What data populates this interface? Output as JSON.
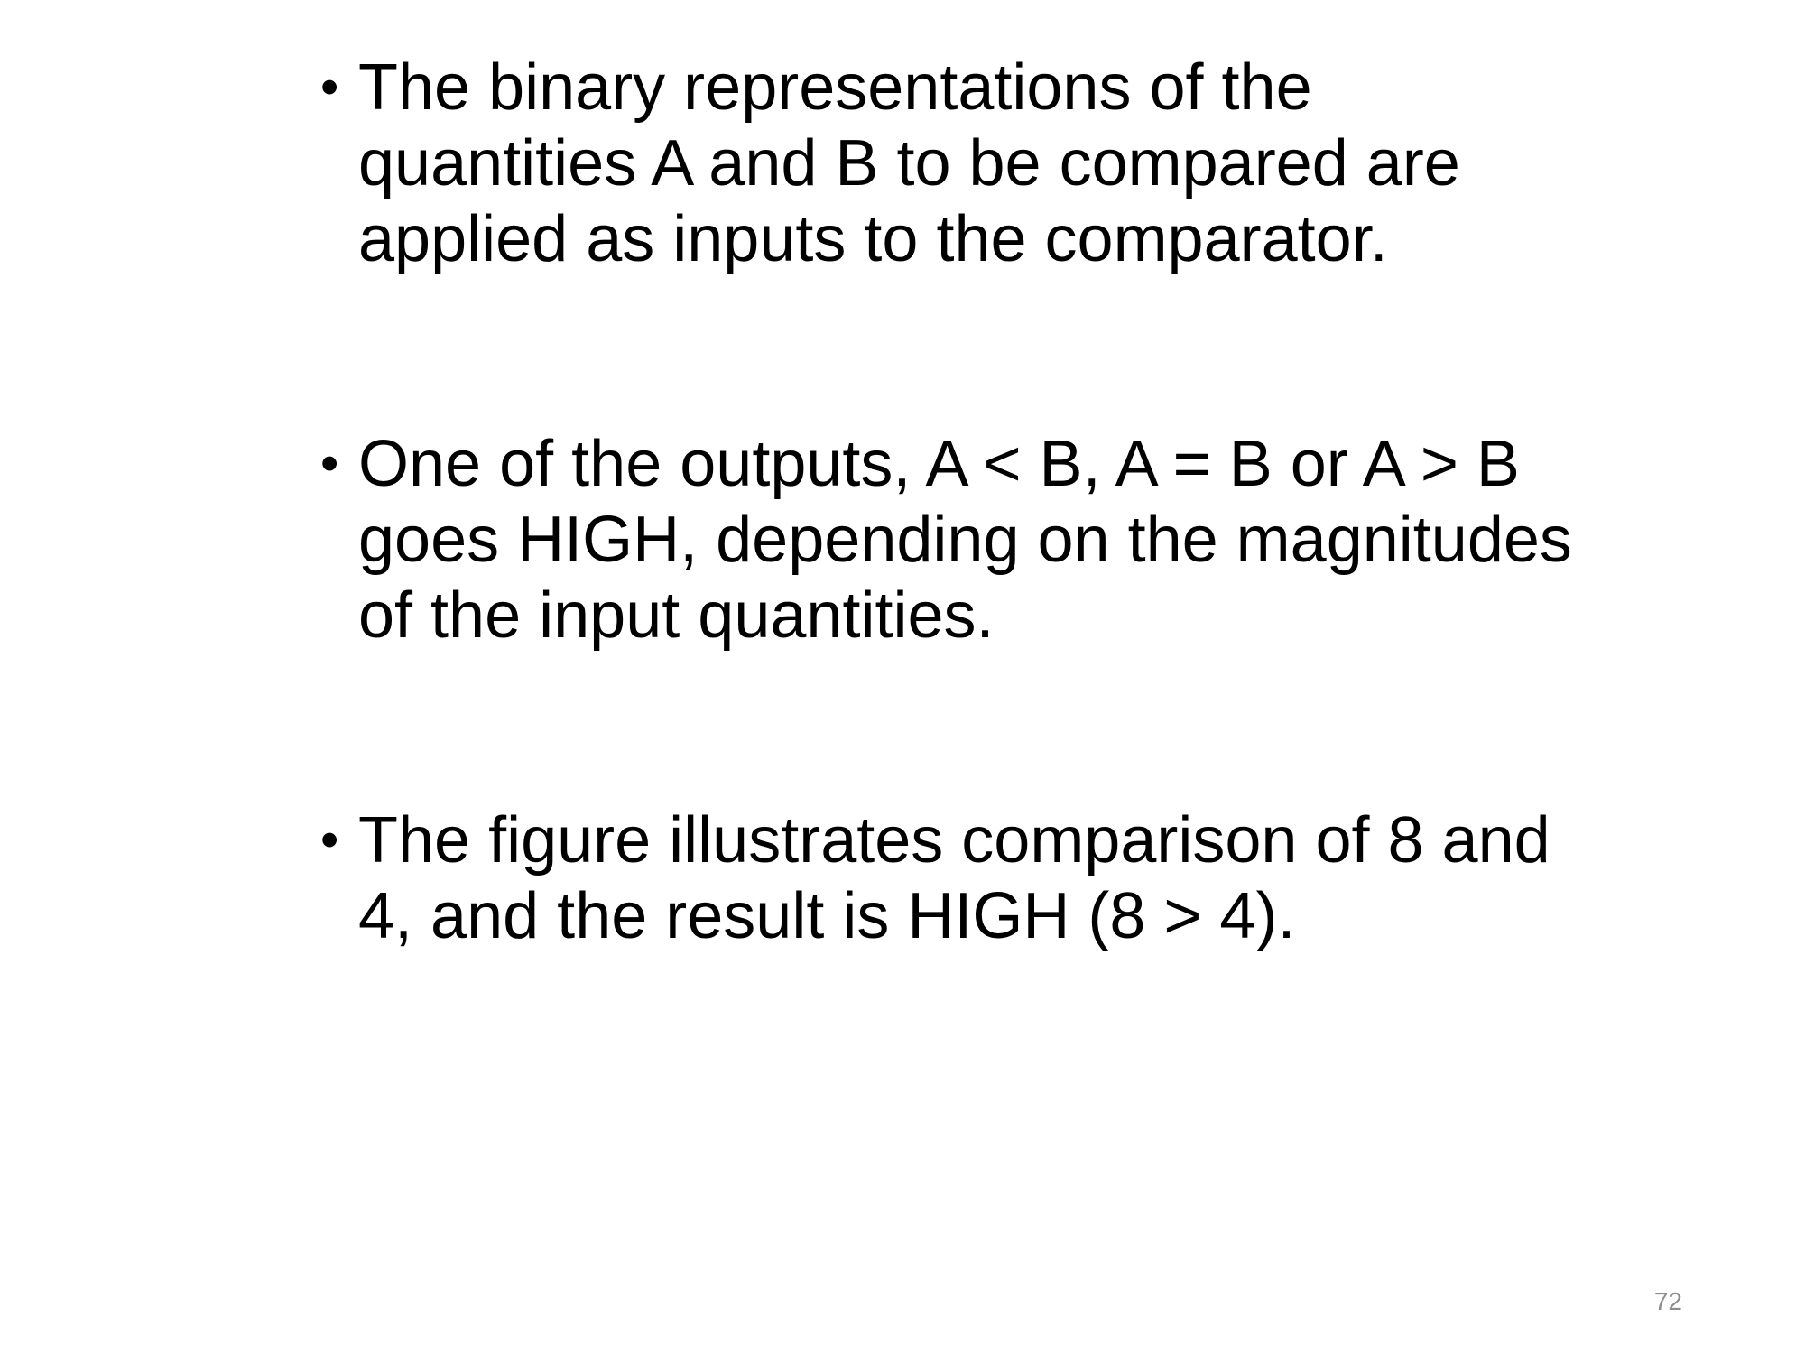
{
  "slide": {
    "bullets": [
      {
        "symbol": "•",
        "text": "The binary representations of the quantities A and B to be compared are applied as inputs to the comparator."
      },
      {
        "symbol": "•",
        "text": "One of the outputs, A < B, A = B or A > B goes HIGH, depending on the magnitudes of the input quantities."
      },
      {
        "symbol": "•",
        "text": "The figure illustrates comparison of 8 and 4, and the result is HIGH (8 > 4)."
      }
    ],
    "page_number": "72"
  }
}
